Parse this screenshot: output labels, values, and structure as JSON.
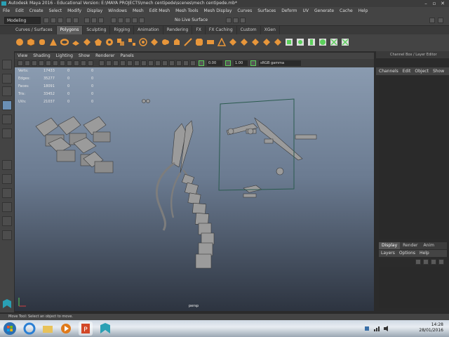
{
  "window": {
    "title": "Autodesk Maya 2016 - Educational Version: E:\\MAYA PROJECTS\\mech centipede\\scenes\\mech centipede.mb*",
    "controls": [
      "–",
      "▫",
      "✕"
    ]
  },
  "menubar": [
    "File",
    "Edit",
    "Create",
    "Select",
    "Modify",
    "Display",
    "Windows",
    "Mesh",
    "Edit Mesh",
    "Mesh Tools",
    "Mesh Display",
    "Curves",
    "Surfaces",
    "Deform",
    "UV",
    "Generate",
    "Cache",
    "Help"
  ],
  "status": {
    "mode": "Modeling",
    "live_surface": "No Live Surface"
  },
  "shelf_tabs": [
    {
      "label": "Curves / Surfaces",
      "active": false
    },
    {
      "label": "Polygons",
      "active": true
    },
    {
      "label": "Sculpting",
      "active": false
    },
    {
      "label": "Rigging",
      "active": false
    },
    {
      "label": "Animation",
      "active": false
    },
    {
      "label": "Rendering",
      "active": false
    },
    {
      "label": "FX",
      "active": false
    },
    {
      "label": "FX Caching",
      "active": false
    },
    {
      "label": "Custom",
      "active": false
    },
    {
      "label": "XGen",
      "active": false
    }
  ],
  "viewport_menu": [
    "View",
    "Shading",
    "Lighting",
    "Show",
    "Renderer",
    "Panels"
  ],
  "viewport_toolbar": {
    "value1": "0.00",
    "value2": "1.00",
    "color_space": "sRGB gamma"
  },
  "hud": {
    "rows": [
      {
        "label": "Verts:",
        "v1": "17433",
        "v2": "0",
        "v3": "0"
      },
      {
        "label": "Edges:",
        "v1": "35277",
        "v2": "0",
        "v3": "0"
      },
      {
        "label": "Faces:",
        "v1": "18091",
        "v2": "0",
        "v3": "0"
      },
      {
        "label": "Tris:",
        "v1": "33452",
        "v2": "0",
        "v3": "0"
      },
      {
        "label": "UVs:",
        "v1": "21037",
        "v2": "0",
        "v3": "0"
      }
    ],
    "camera": "persp"
  },
  "right_panel": {
    "header": "Channel Box / Layer Editor",
    "menu": [
      "Channels",
      "Edit",
      "Object",
      "Show"
    ],
    "layer_tabs": [
      {
        "label": "Display",
        "active": true
      },
      {
        "label": "Render",
        "active": false
      },
      {
        "label": "Anim",
        "active": false
      }
    ],
    "layer_menu": [
      "Layers",
      "Options",
      "Help"
    ]
  },
  "helpline": "Move Tool: Select an object to move.",
  "taskbar": {
    "time": "14:28",
    "date": "28/01/2016"
  },
  "colors": {
    "accent_orange": "#e8963a",
    "accent_green": "#5bd05b",
    "maya_teal": "#2aa0b4"
  }
}
